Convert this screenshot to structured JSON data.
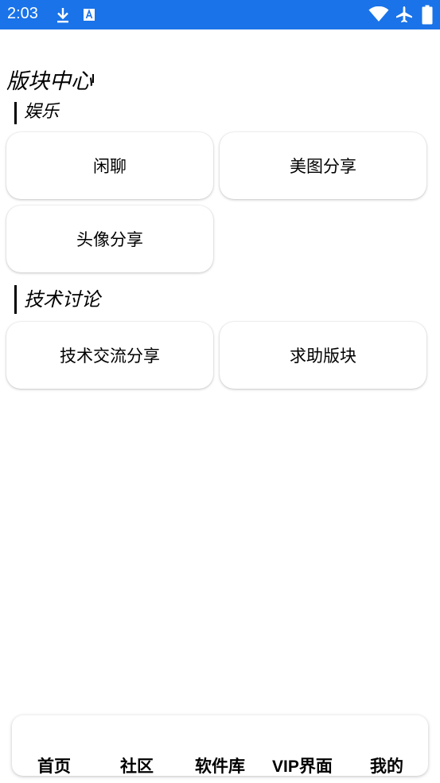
{
  "status_bar": {
    "time": "2:03",
    "icons": [
      "download-icon",
      "font-a-icon",
      "wifi-icon",
      "airplane-icon",
      "battery-icon"
    ],
    "color": "#1a73e8"
  },
  "page": {
    "title": "版块中心"
  },
  "sections": [
    {
      "heading": "娱乐",
      "items": [
        "闲聊",
        "美图分享",
        "头像分享"
      ]
    },
    {
      "heading": "技术讨论",
      "items": [
        "技术交流分享",
        "求助版块"
      ]
    }
  ],
  "bottom_nav": {
    "items": [
      "首页",
      "社区",
      "软件库",
      "VIP界面",
      "我的"
    ]
  }
}
